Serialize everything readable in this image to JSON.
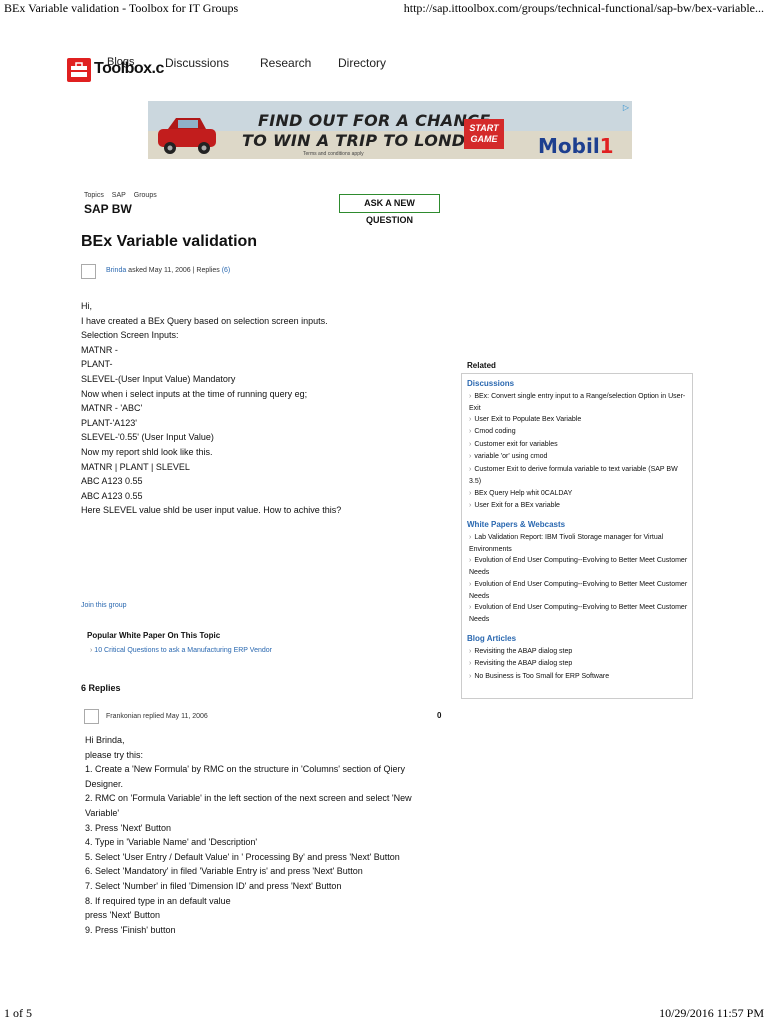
{
  "print": {
    "title": "BEx Variable validation - Toolbox for IT Groups",
    "url": "http://sap.ittoolbox.com/groups/technical-functional/sap-bw/bex-variable...",
    "page": "1 of 5",
    "datetime": "10/29/2016 11:57 PM"
  },
  "nav": {
    "logo_text": "Toolbox.c",
    "logo_overlap": "Blogs",
    "items": [
      "Discussions",
      "Research",
      "Directory"
    ]
  },
  "ad": {
    "headline_1": "FIND OUT FOR A CHANCE",
    "headline_2": "TO WIN A TRIP TO LONDON!",
    "terms": "Terms and conditions apply",
    "start_1": "START",
    "start_2": "GAME",
    "brand": "Mobil",
    "brand_num": "1",
    "adchoice": "▷"
  },
  "breadcrumb": [
    "Topics",
    "SAP",
    "Groups"
  ],
  "category": "SAP BW",
  "ask_button": "ASK A NEW QUESTION",
  "post": {
    "title": "BEx Variable validation",
    "author": "Brinda",
    "asked": " asked May 11, 2006 | Replies ",
    "replies_link": "(6)",
    "lines": [
      "Hi,",
      "",
      "I have created a BEx Query based on selection screen inputs.",
      "",
      "Selection Screen Inputs:",
      "MATNR -",
      "PLANT-",
      "SLEVEL-(User Input Value) Mandatory",
      "",
      "Now when i select inputs at the time of running query eg;",
      "MATNR - 'ABC'",
      "PLANT-'A123'",
      "SLEVEL-'0.55' (User Input Value)",
      "",
      "Now my report shld look like this.",
      "MATNR | PLANT | SLEVEL",
      "ABC A123 0.55",
      "ABC A123 0.55",
      "",
      "Here SLEVEL value shld be user input value. How to achive this?"
    ],
    "join": "Join this group"
  },
  "popular": {
    "heading": "Popular White Paper On This Topic",
    "link": "10 Critical Questions to ask a Manufacturing ERP Vendor"
  },
  "replies_heading": "6 Replies",
  "reply": {
    "author_line": "Frankonian replied May 11, 2006",
    "count": "0",
    "lines": [
      "Hi Brinda,",
      "",
      "please try this:",
      "",
      "1. Create a 'New Formula' by RMC on the structure in 'Columns' section of Qiery",
      "Designer.",
      "2. RMC on 'Formula Variable' in the left section of the next screen and select 'New",
      "Variable'",
      "3. Press 'Next' Button",
      "4. Type in 'Variable Name' and 'Description'",
      "5. Select 'User Entry / Default Value' in ' Processing By' and press 'Next' Button",
      "6. Select 'Mandatory' in filed 'Variable Entry is' and press 'Next' Button",
      "7. Select 'Number' in filed 'Dimension ID' and press 'Next' Button",
      "8. If required type in an default value",
      "press 'Next' Button",
      "9. Press 'Finish' button"
    ]
  },
  "related": {
    "heading": "Related",
    "discussions_h": "Discussions",
    "discussions": [
      "BEx: Convert single entry input to a Range/selection Option in User-Exit",
      "User Exit to Populate Bex Variable",
      "Cmod coding",
      "Customer exit for variables",
      "variable 'or' using cmod",
      "Customer Exit to derive formula variable to text variable (SAP BW 3.5)",
      "BEx Query Help whit 0CALDAY",
      "User Exit for a BEx variable"
    ],
    "papers_h": "White Papers & Webcasts",
    "papers": [
      "Lab Validation Report: IBM Tivoli Storage manager for Virtual Environments",
      "Evolution of End User Computing--Evolving to Better Meet Customer Needs",
      "Evolution of End User Computing--Evolving to Better Meet Customer Needs",
      "Evolution of End User Computing--Evolving to Better Meet Customer Needs"
    ],
    "blogs_h": "Blog Articles",
    "blogs": [
      "Revisiting the ABAP dialog step",
      "Revisiting the ABAP dialog step",
      "No Business is Too Small for ERP Software"
    ]
  }
}
